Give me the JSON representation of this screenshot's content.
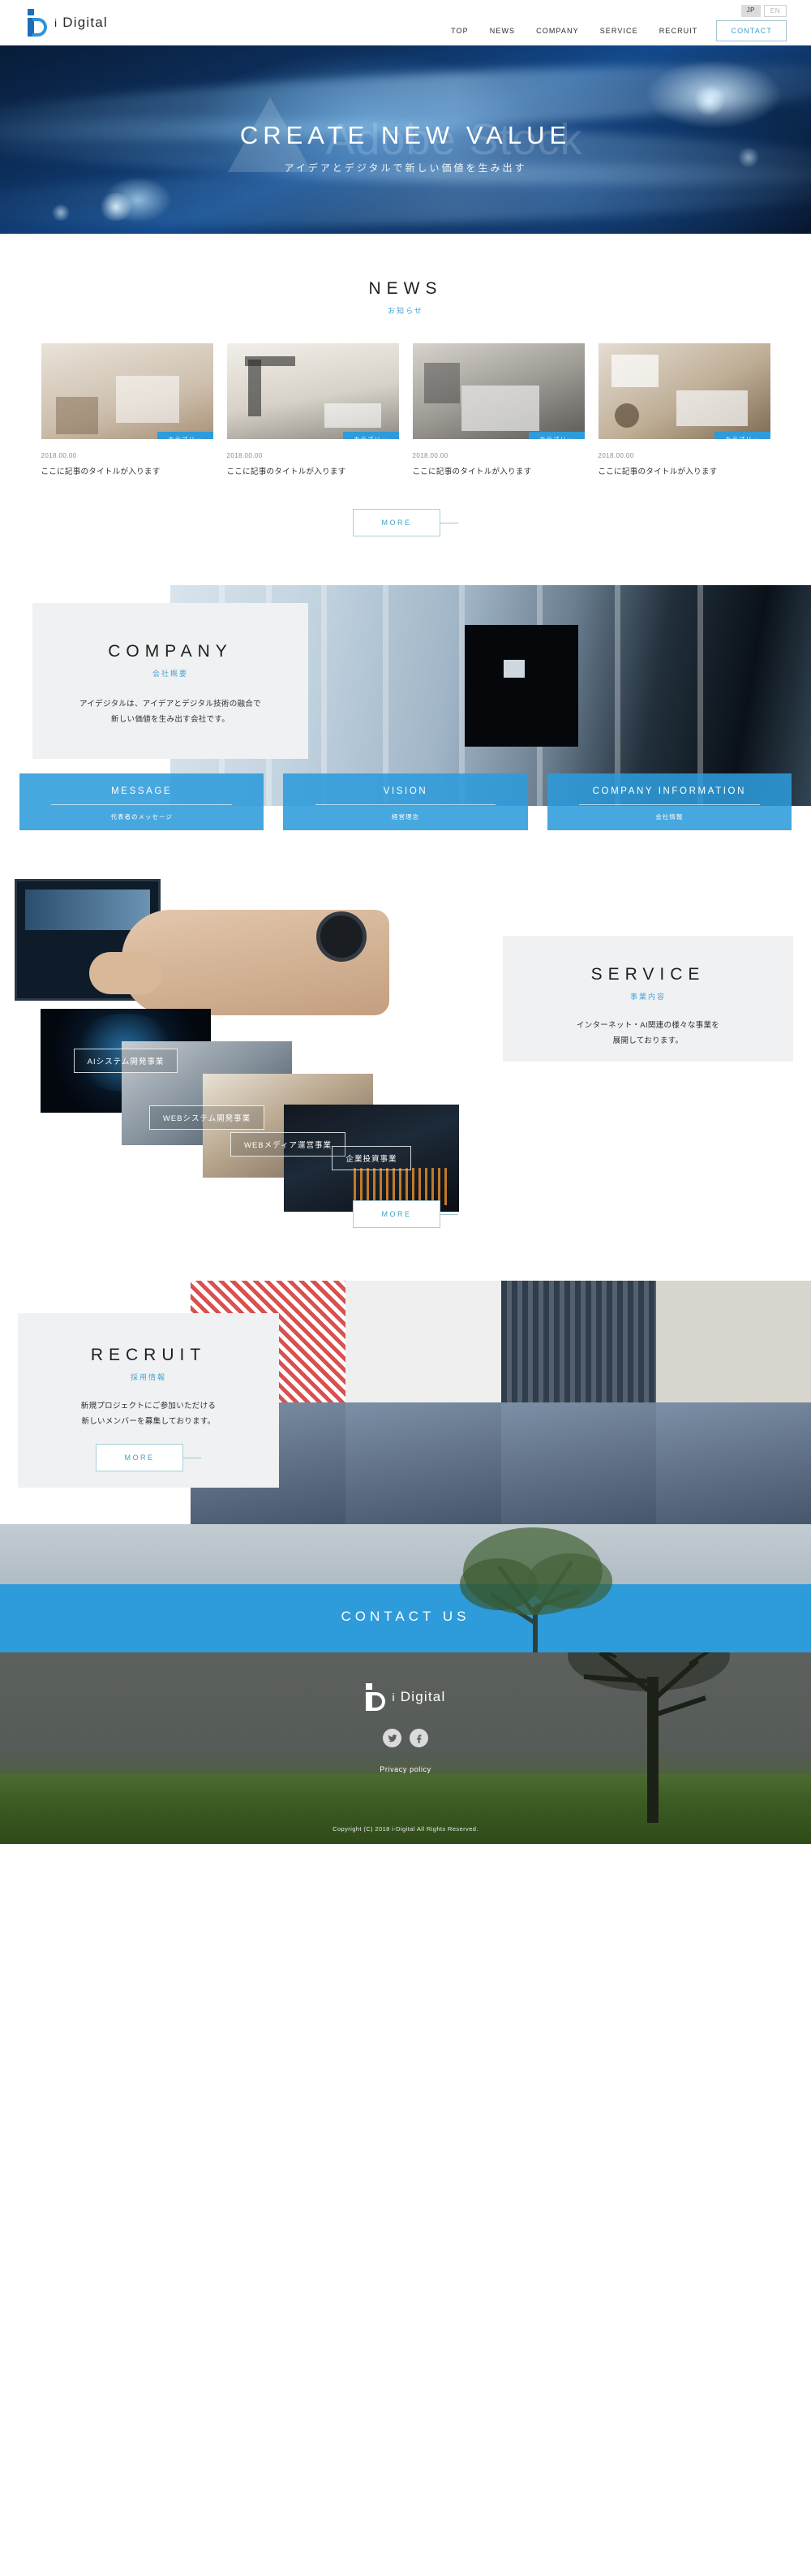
{
  "header": {
    "logo_text_i": "i",
    "logo_text_name": "Digital",
    "lang": {
      "jp": "JP",
      "en": "EN"
    },
    "nav": [
      {
        "label": "TOP"
      },
      {
        "label": "NEWS"
      },
      {
        "label": "COMPANY"
      },
      {
        "label": "SERVICE"
      },
      {
        "label": "RECRUIT"
      }
    ],
    "contact_label": "CONTACT"
  },
  "hero": {
    "title": "CREATE NEW VALUE",
    "subtitle": "アイデアとデジタルで新しい価値を生み出す",
    "watermark": "Adobe Stock"
  },
  "news": {
    "title": "NEWS",
    "subtitle": "お知らせ",
    "more_label": "MORE",
    "items": [
      {
        "category": "カテゴリー",
        "date": "2018.00.00",
        "title": "ここに記事のタイトルが入ります"
      },
      {
        "category": "カテゴリー",
        "date": "2018.00.00",
        "title": "ここに記事のタイトルが入ります"
      },
      {
        "category": "カテゴリー",
        "date": "2018.00.00",
        "title": "ここに記事のタイトルが入ります"
      },
      {
        "category": "カテゴリー",
        "date": "2018.00.00",
        "title": "ここに記事のタイトルが入ります"
      }
    ]
  },
  "company": {
    "title": "COMPANY",
    "subtitle": "会社概要",
    "description_line1": "アイデジタルは、アイデアとデジタル技術の融合で",
    "description_line2": "新しい価値を生み出す会社です。",
    "buttons": [
      {
        "label": "MESSAGE",
        "sub": "代表者のメッセージ"
      },
      {
        "label": "VISION",
        "sub": "経営理念"
      },
      {
        "label": "COMPANY INFORMATION",
        "sub": "会社情報"
      }
    ]
  },
  "service": {
    "title": "SERVICE",
    "subtitle": "事業内容",
    "description_line1": "インターネット・AI関連の様々な事業を",
    "description_line2": "展開しております。",
    "more_label": "MORE",
    "cards": [
      {
        "label": "AIシステム開発事業"
      },
      {
        "label": "WEBシステム開発事業"
      },
      {
        "label": "WEBメディア運営事業"
      },
      {
        "label": "企業投資事業"
      }
    ]
  },
  "recruit": {
    "title": "RECRUIT",
    "subtitle": "採用情報",
    "description_line1": "新規プロジェクトにご参加いただける",
    "description_line2": "新しいメンバーを募集しております。",
    "more_label": "MORE"
  },
  "contact": {
    "label": "CONTACT US"
  },
  "footer": {
    "logo_text_i": "i",
    "logo_text_name": "Digital",
    "social": [
      {
        "name": "twitter",
        "glyph": "🐦"
      },
      {
        "name": "facebook",
        "glyph": "f"
      }
    ],
    "privacy_label": "Privacy policy",
    "copyright": "Copyright (C) 2018 i-Digital All Rights Reserved."
  },
  "colors": {
    "accent_blue": "#2e9bdb",
    "link_blue": "#3ea2c6",
    "dark_navy": "#081c38"
  }
}
